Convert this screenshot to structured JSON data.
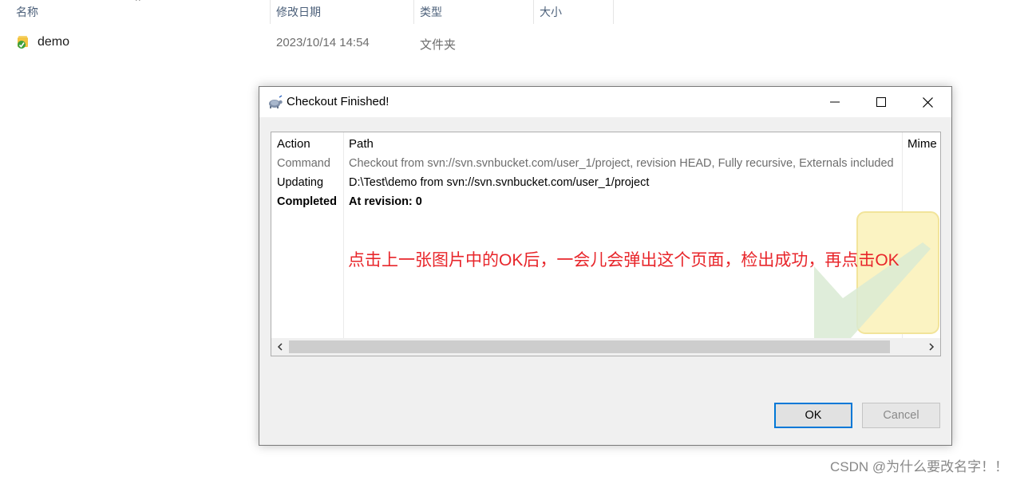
{
  "explorer": {
    "columns": {
      "name": "名称",
      "modified": "修改日期",
      "type": "类型",
      "size": "大小"
    },
    "sort_indicator": "^",
    "rows": [
      {
        "name": "demo",
        "modified": "2023/10/14 14:54",
        "type": "文件夹",
        "icon": "svn-folder-icon"
      }
    ]
  },
  "dialog": {
    "title": "Checkout Finished!",
    "list": {
      "headers": {
        "action": "Action",
        "path": "Path",
        "mime": "Mime"
      },
      "rows": [
        {
          "action": "Command",
          "path": "Checkout from svn://svn.svnbucket.com/user_1/project, revision HEAD, Fully recursive, Externals included",
          "style": "gray"
        },
        {
          "action": "Updating",
          "path": "D:\\Test\\demo from svn://svn.svnbucket.com/user_1/project",
          "style": "black"
        },
        {
          "action": "Completed",
          "path": "At revision: 0",
          "style": "bold"
        }
      ]
    },
    "annotation": "点击上一张图片中的OK后，一会儿会弹出这个页面，检出成功，再点击OK",
    "buttons": {
      "ok": "OK",
      "cancel": "Cancel"
    }
  },
  "watermark": "CSDN @为什么要改名字！！",
  "colors": {
    "annotation_red": "#e8262b",
    "ok_focus_blue": "#0078d7"
  }
}
